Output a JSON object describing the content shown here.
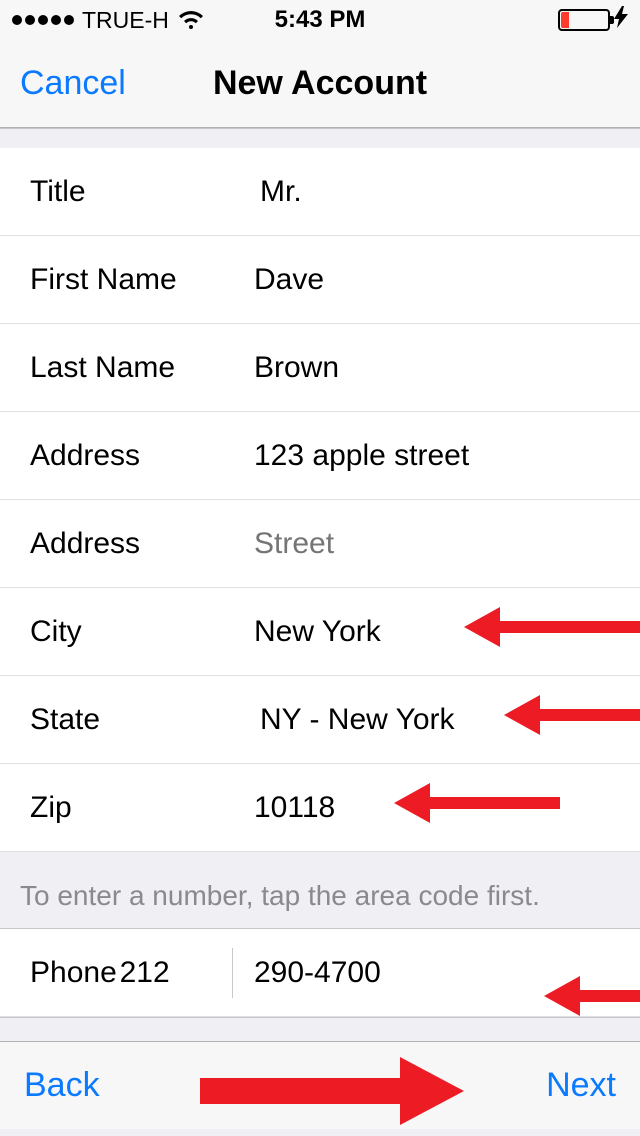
{
  "statusbar": {
    "carrier": "TRUE-H",
    "time": "5:43 PM"
  },
  "navbar": {
    "cancel": "Cancel",
    "title": "New Account"
  },
  "form": {
    "title": {
      "label": "Title",
      "value": "Mr."
    },
    "first_name": {
      "label": "First Name",
      "value": "Dave"
    },
    "last_name": {
      "label": "Last Name",
      "value": "Brown"
    },
    "address1": {
      "label": "Address",
      "value": "123 apple street"
    },
    "address2": {
      "label": "Address",
      "placeholder": "Street",
      "value": ""
    },
    "city": {
      "label": "City",
      "value": "New York"
    },
    "state": {
      "label": "State",
      "value": "NY - New York"
    },
    "zip": {
      "label": "Zip",
      "value": "10118"
    },
    "phone_hint": "To enter a number, tap the area code first.",
    "phone": {
      "label": "Phone",
      "area_code": "212",
      "number": "290-4700"
    }
  },
  "toolbar": {
    "back": "Back",
    "next": "Next"
  }
}
